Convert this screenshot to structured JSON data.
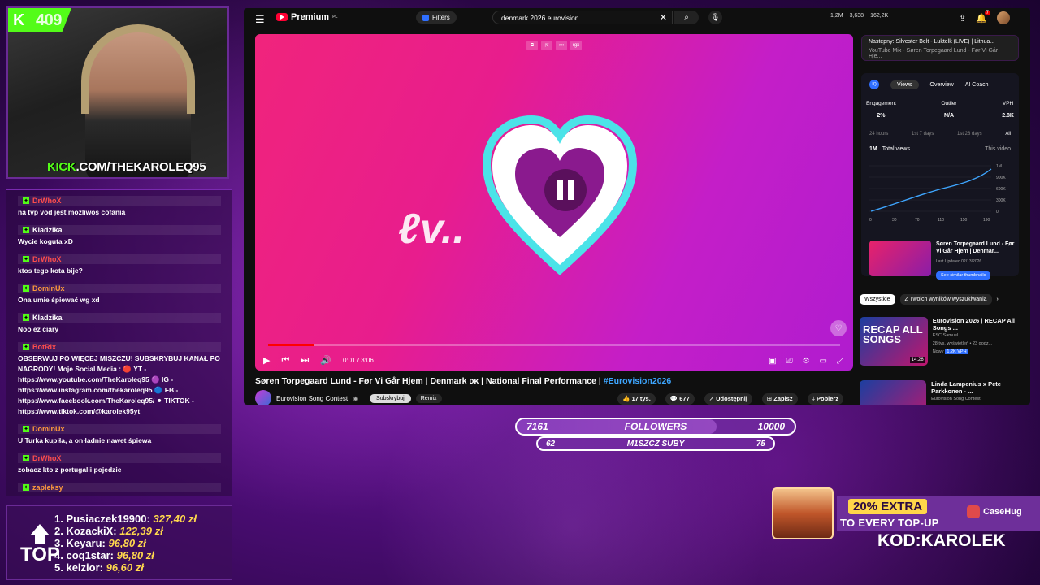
{
  "stream": {
    "kick_badge_text": "409",
    "kick_url_prefix": "KICK",
    "kick_url_suffix": ".COM/THEKAROLEQ95"
  },
  "chat": {
    "messages": [
      {
        "user": "DrWhoX",
        "text": "na tvp vod jest mozliwos cofania",
        "color": "#ff4d4d"
      },
      {
        "user": "Kladzika",
        "text": "Wycie koguta xD",
        "color": "#ffffff"
      },
      {
        "user": "DrWhoX",
        "text": "ktos tego kota bije?",
        "color": "#ff4d4d"
      },
      {
        "user": "DominUx",
        "text": "Ona umie śpiewać wg xd",
        "color": "#ff9a3c"
      },
      {
        "user": "Kladzika",
        "text": "Noo eż ciary",
        "color": "#ffffff"
      },
      {
        "user": "BotRix",
        "text": "OBSERWUJ PO WIĘCEJ MISZCZU! SUBSKRYBUJ KANAŁ PO NAGRODY! Moje Social Media : 🔴 YT - https://www.youtube.com/TheKaroleq95 🟣 IG - https://www.instagram.com/thekaroleq95 🔵 FB - https://www.facebook.com/TheKaroleq95/ ⚫ TIKTOK - https://www.tiktok.com/@karolek95yt",
        "color": "#ff4d4d"
      },
      {
        "user": "DominUx",
        "text": "U Turka kupiła, a on ładnie nawet śpiewa",
        "color": "#ff9a3c"
      },
      {
        "user": "DrWhoX",
        "text": "zobacz kto z portugalii pojedzie",
        "color": "#ff4d4d"
      },
      {
        "user": "zapleksy",
        "text": "siema",
        "color": "#ff9a3c"
      }
    ]
  },
  "leaderboard": {
    "label": "TOP",
    "entries": [
      {
        "rank": "1.",
        "name": "Pusiaczek19900:",
        "amount": "327,40 zł"
      },
      {
        "rank": "2.",
        "name": "KozackiX:",
        "amount": "122,39 zł"
      },
      {
        "rank": "3.",
        "name": "Keyaru:",
        "amount": "96,80 zł"
      },
      {
        "rank": "4.",
        "name": "coq1star:",
        "amount": "96,80 zł"
      },
      {
        "rank": "5.",
        "name": "kelzior:",
        "amount": "96,60 zł"
      }
    ]
  },
  "youtube": {
    "logo": "Premium",
    "logo_suffix": "PL",
    "filters": "Filters",
    "search_value": "denmark 2026 eurovision",
    "stats": [
      "1,2M",
      "3,638",
      "162,2K"
    ],
    "notif_count": "7",
    "video": {
      "time": "0:01 / 3:06",
      "overlay_text": "ℓv..",
      "progress": 0.08,
      "title": "Søren Torpegaard Lund - Før Vi Går Hjem | Denmark ᴅᴋ | National Final Performance | ",
      "hashtag": "#Eurovision2026",
      "channel": "Eurovision Song Contest",
      "subscribe": "Subskrybuj",
      "remix": "Remix",
      "likes": "17 tys.",
      "comments": "677",
      "share": "Udostępnij",
      "save": "Zapisz",
      "download": "Pobierz"
    },
    "next_up": {
      "title": "Następny: Silvester Belt - Luktelk (LIVE) | Lithua...",
      "sub": "YouTube Mix - Søren Torpegaard Lund - Før Vi Går Hje..."
    },
    "vidiq": {
      "tabs": [
        "Views",
        "Overview",
        "AI Coach"
      ],
      "metrics": [
        {
          "label": "Engagement",
          "value": "2%"
        },
        {
          "label": "Outlier",
          "value": "N/A"
        },
        {
          "label": "VPH",
          "value": "2.8K"
        }
      ],
      "ranges": [
        "24 hours",
        "1st 7 days",
        "1st 28 days",
        "All"
      ],
      "chart_total": "1M",
      "chart_label": "Total views",
      "chart_this": "This video",
      "chart_y_ticks": [
        "1M",
        "900K",
        "600K",
        "300K",
        "0"
      ],
      "chart_x_ticks": [
        "0",
        "30",
        "70",
        "110",
        "150",
        "190"
      ],
      "thumb_title": "Søren Torpegaard Lund - Før Vi Går Hjem | Denmar...",
      "thumb_date": "Last Updated 02/13/2026",
      "thumb_btn": "See similar thumbnails"
    },
    "chips": {
      "active": "Wszystkie",
      "other": "Z Twoich wyników wyszukiwania"
    },
    "recs": [
      {
        "thumb": "RECAP ALL SONGS",
        "title": "Eurovision 2026 | RECAP All Songs ...",
        "channel": "ESC Samuel",
        "meta": "28 tys. wyświetleń • 23 godz...",
        "duration": "14:26",
        "badge": "Nowy",
        "views": "1.2K VPH"
      },
      {
        "thumb": "",
        "title": "Linda Lampenius x Pete Parkkonen - ...",
        "channel": "Eurovision Song Contest",
        "meta": "",
        "duration": "",
        "badge": "",
        "views": ""
      }
    ]
  },
  "goals": {
    "followers": {
      "current": "7161",
      "label": "FOLLOWERS",
      "target": "10000",
      "progress": 0.72
    },
    "subs": {
      "current": "62",
      "label": "M1SZCZ SUBY",
      "target": "75",
      "progress": 0.83
    }
  },
  "promo": {
    "extra": "20% EXTRA",
    "topup": "TO EVERY TOP-UP",
    "brand": "CaseHug",
    "code": "KOD:KAROLEK"
  }
}
